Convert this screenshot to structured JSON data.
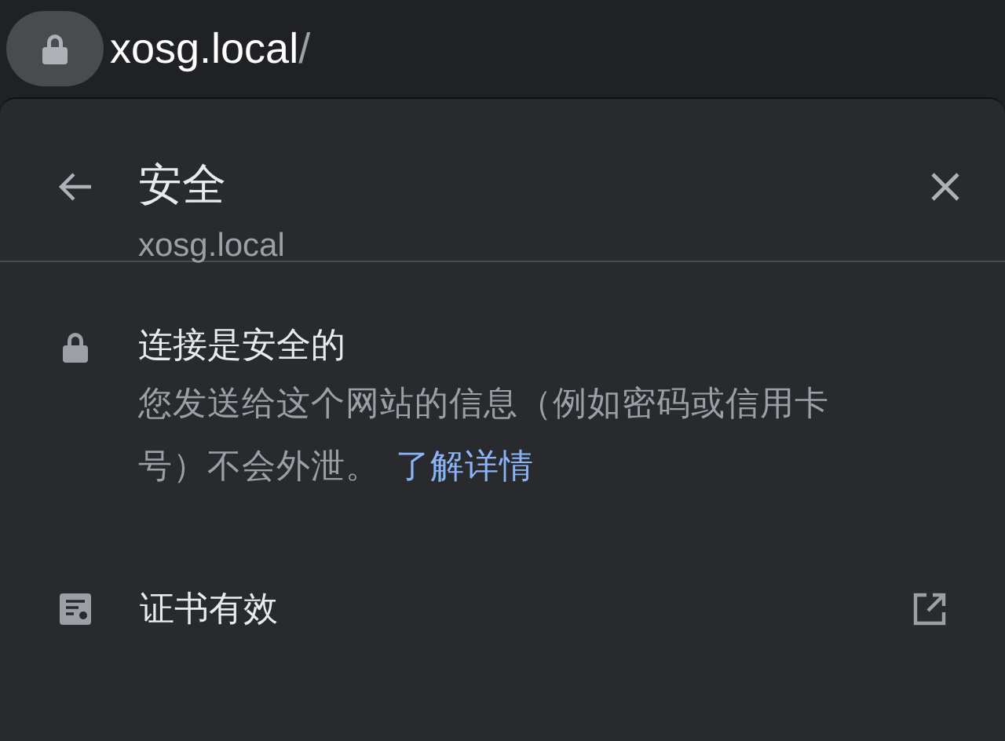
{
  "address_bar": {
    "host": "xosg.local",
    "path": "/"
  },
  "header": {
    "title": "安全",
    "subtitle": "xosg.local"
  },
  "connection": {
    "title": "连接是安全的",
    "description": "您发送给这个网站的信息（例如密码或信用卡号）不会外泄。",
    "link": "了解详情"
  },
  "certificate": {
    "label": "证书有效"
  }
}
